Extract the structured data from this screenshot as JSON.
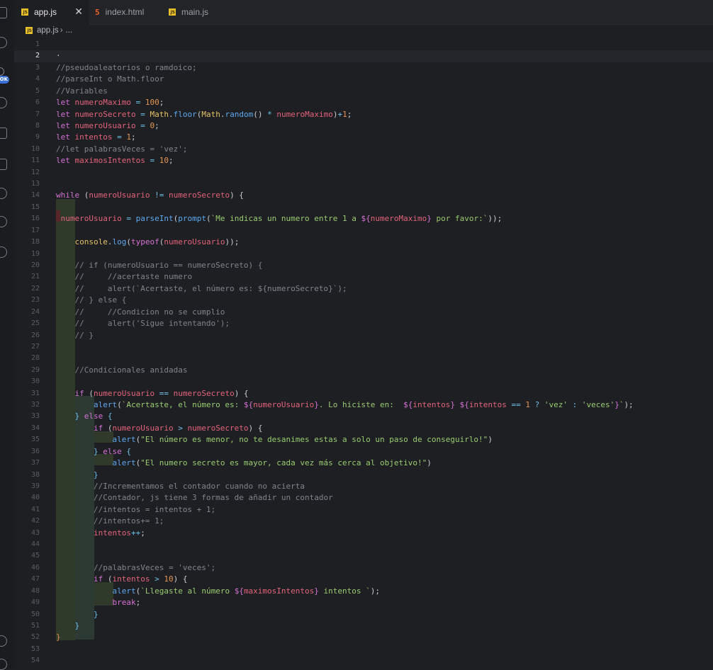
{
  "tabs": [
    {
      "label": "app.js",
      "type": "js",
      "active": true
    },
    {
      "label": "index.html",
      "type": "html",
      "active": false
    },
    {
      "label": "main.js",
      "type": "js",
      "active": false
    }
  ],
  "tab_close_glyph": "✕",
  "breadcrumb": {
    "file": "app.js",
    "rest": "..."
  },
  "activity_badge": "OK",
  "current_line": 2,
  "colors": {
    "keyword": "#d572d7",
    "variable": "#e4637c",
    "number": "#e59553",
    "operator": "#6fc2e8",
    "function": "#5ea9f0",
    "class": "#e5c268",
    "string": "#9acb72",
    "comment": "#7f848e"
  },
  "lines": [
    [],
    [
      [
        "pl",
        "·"
      ]
    ],
    [
      [
        "cm",
        "//pseudoaleatorios o ramdoico;"
      ]
    ],
    [
      [
        "cm",
        "//parseInt o Math.floor"
      ]
    ],
    [
      [
        "cm",
        "//Variables"
      ]
    ],
    [
      [
        "kw",
        "let "
      ],
      [
        "var",
        "numeroMaximo"
      ],
      [
        "op",
        " = "
      ],
      [
        "num",
        "100"
      ],
      [
        "pl",
        ";"
      ]
    ],
    [
      [
        "kw",
        "let "
      ],
      [
        "var",
        "numeroSecreto"
      ],
      [
        "op",
        " = "
      ],
      [
        "cls",
        "Math"
      ],
      [
        "pl",
        "."
      ],
      [
        "fn",
        "floor"
      ],
      [
        "pl",
        "("
      ],
      [
        "cls",
        "Math"
      ],
      [
        "pl",
        "."
      ],
      [
        "fn",
        "random"
      ],
      [
        "pl",
        "() "
      ],
      [
        "op",
        "* "
      ],
      [
        "var",
        "numeroMaximo"
      ],
      [
        "pl",
        ")"
      ],
      [
        "op",
        "+"
      ],
      [
        "num",
        "1"
      ],
      [
        "pl",
        ";"
      ]
    ],
    [
      [
        "kw",
        "let "
      ],
      [
        "var",
        "numeroUsuario"
      ],
      [
        "op",
        " = "
      ],
      [
        "num",
        "0"
      ],
      [
        "pl",
        ";"
      ]
    ],
    [
      [
        "kw",
        "let "
      ],
      [
        "var",
        "intentos"
      ],
      [
        "op",
        " = "
      ],
      [
        "num",
        "1"
      ],
      [
        "pl",
        ";"
      ]
    ],
    [
      [
        "cm",
        "//let palabrasVeces = 'vez';"
      ]
    ],
    [
      [
        "kw",
        "let "
      ],
      [
        "var",
        "maximosIntentos"
      ],
      [
        "op",
        " = "
      ],
      [
        "num",
        "10"
      ],
      [
        "pl",
        ";"
      ]
    ],
    [],
    [],
    [
      [
        "kw",
        "while "
      ],
      [
        "pl",
        "("
      ],
      [
        "var",
        "numeroUsuario"
      ],
      [
        "op",
        " != "
      ],
      [
        "var",
        "numeroSecreto"
      ],
      [
        "pl",
        ") {"
      ]
    ],
    [],
    [
      [
        "pl",
        " "
      ],
      [
        "var",
        "numeroUsuario"
      ],
      [
        "op",
        " = "
      ],
      [
        "fn",
        "parseInt"
      ],
      [
        "pl",
        "("
      ],
      [
        "fn",
        "prompt"
      ],
      [
        "pl",
        "("
      ],
      [
        "str",
        "`Me indicas un numero entre 1 a "
      ],
      [
        "kw",
        "${"
      ],
      [
        "var",
        "numeroMaximo"
      ],
      [
        "kw",
        "}"
      ],
      [
        "str",
        " por favor:`"
      ],
      [
        "pl",
        "));"
      ]
    ],
    [],
    [
      [
        "pl",
        "    "
      ],
      [
        "cls",
        "console"
      ],
      [
        "pl",
        "."
      ],
      [
        "fn",
        "log"
      ],
      [
        "pl",
        "("
      ],
      [
        "kw",
        "typeof"
      ],
      [
        "pl",
        "("
      ],
      [
        "var",
        "numeroUsuario"
      ],
      [
        "pl",
        "));"
      ]
    ],
    [],
    [
      [
        "pl",
        "    "
      ],
      [
        "cm",
        "// if (numeroUsuario == numeroSecreto) {"
      ]
    ],
    [
      [
        "pl",
        "    "
      ],
      [
        "cm",
        "//     //acertaste numero"
      ]
    ],
    [
      [
        "pl",
        "    "
      ],
      [
        "cm",
        "//     alert(`Acertaste, el número es: ${numeroSecreto}`);"
      ]
    ],
    [
      [
        "pl",
        "    "
      ],
      [
        "cm",
        "// } else {"
      ]
    ],
    [
      [
        "pl",
        "    "
      ],
      [
        "cm",
        "//     //Condicion no se cumplio"
      ]
    ],
    [
      [
        "pl",
        "    "
      ],
      [
        "cm",
        "//     alert('Sigue intentando');"
      ]
    ],
    [
      [
        "pl",
        "    "
      ],
      [
        "cm",
        "// }"
      ]
    ],
    [],
    [],
    [
      [
        "pl",
        "    "
      ],
      [
        "cm",
        "//Condicionales anidadas"
      ]
    ],
    [],
    [
      [
        "pl",
        "    "
      ],
      [
        "kw",
        "if "
      ],
      [
        "pl",
        "("
      ],
      [
        "var",
        "numeroUsuario"
      ],
      [
        "op",
        " == "
      ],
      [
        "var",
        "numeroSecreto"
      ],
      [
        "pl",
        ") {"
      ]
    ],
    [
      [
        "pl",
        "        "
      ],
      [
        "fn",
        "alert"
      ],
      [
        "pl",
        "("
      ],
      [
        "str",
        "`Acertaste, el número es: "
      ],
      [
        "kw",
        "${"
      ],
      [
        "var",
        "numeroUsuario"
      ],
      [
        "kw",
        "}"
      ],
      [
        "str",
        ". Lo hiciste en:  "
      ],
      [
        "kw",
        "${"
      ],
      [
        "var",
        "intentos"
      ],
      [
        "kw",
        "}"
      ],
      [
        "str",
        " "
      ],
      [
        "kw",
        "${"
      ],
      [
        "var",
        "intentos"
      ],
      [
        "op",
        " == "
      ],
      [
        "num",
        "1"
      ],
      [
        "op",
        " ? "
      ],
      [
        "str",
        "'vez'"
      ],
      [
        "op",
        " : "
      ],
      [
        "str",
        "'veces'"
      ],
      [
        "kw",
        "}"
      ],
      [
        "str",
        "`"
      ],
      [
        "pl",
        ");"
      ]
    ],
    [
      [
        "pl",
        "    "
      ],
      [
        "op",
        "} "
      ],
      [
        "kw",
        "else "
      ],
      [
        "op",
        "{"
      ]
    ],
    [
      [
        "pl",
        "        "
      ],
      [
        "kw",
        "if "
      ],
      [
        "pl",
        "("
      ],
      [
        "var",
        "numeroUsuario"
      ],
      [
        "op",
        " > "
      ],
      [
        "var",
        "numeroSecreto"
      ],
      [
        "pl",
        ") {"
      ]
    ],
    [
      [
        "pl",
        "            "
      ],
      [
        "fn",
        "alert"
      ],
      [
        "pl",
        "("
      ],
      [
        "str",
        "\"El número es menor, no te desanimes estas a solo un paso de conseguirlo!\""
      ],
      [
        "pl",
        ")"
      ]
    ],
    [
      [
        "pl",
        "        "
      ],
      [
        "op",
        "} "
      ],
      [
        "kw",
        "else "
      ],
      [
        "op",
        "{"
      ]
    ],
    [
      [
        "pl",
        "            "
      ],
      [
        "fn",
        "alert"
      ],
      [
        "pl",
        "("
      ],
      [
        "str",
        "\"El numero secreto es mayor, cada vez más cerca al objetivo!\""
      ],
      [
        "pl",
        ")"
      ]
    ],
    [
      [
        "pl",
        "        "
      ],
      [
        "op",
        "}"
      ]
    ],
    [
      [
        "pl",
        "        "
      ],
      [
        "cm",
        "//Incrementamos el contador cuando no acierta"
      ]
    ],
    [
      [
        "pl",
        "        "
      ],
      [
        "cm",
        "//Contador, js tiene 3 formas de añadir un contador"
      ]
    ],
    [
      [
        "pl",
        "        "
      ],
      [
        "cm",
        "//intentos = intentos + 1;"
      ]
    ],
    [
      [
        "pl",
        "        "
      ],
      [
        "cm",
        "//intentos+= 1;"
      ]
    ],
    [
      [
        "pl",
        "        "
      ],
      [
        "var",
        "intentos"
      ],
      [
        "op",
        "++"
      ],
      [
        "pl",
        ";"
      ]
    ],
    [],
    [],
    [
      [
        "pl",
        "        "
      ],
      [
        "cm",
        "//palabrasVeces = 'veces';"
      ]
    ],
    [
      [
        "pl",
        "        "
      ],
      [
        "kw",
        "if "
      ],
      [
        "pl",
        "("
      ],
      [
        "var",
        "intentos"
      ],
      [
        "op",
        " > "
      ],
      [
        "num",
        "10"
      ],
      [
        "pl",
        ") {"
      ]
    ],
    [
      [
        "pl",
        "            "
      ],
      [
        "fn",
        "alert"
      ],
      [
        "pl",
        "("
      ],
      [
        "str",
        "`Llegaste al número "
      ],
      [
        "kw",
        "${"
      ],
      [
        "var",
        "maximosIntentos"
      ],
      [
        "kw",
        "}"
      ],
      [
        "str",
        " intentos `"
      ],
      [
        "pl",
        ");"
      ]
    ],
    [
      [
        "pl",
        "            "
      ],
      [
        "kw",
        "break"
      ],
      [
        "pl",
        ";"
      ]
    ],
    [
      [
        "pl",
        "        "
      ],
      [
        "op",
        "}"
      ]
    ],
    [
      [
        "pl",
        "    "
      ],
      [
        "op",
        "}"
      ]
    ],
    [
      [
        "num",
        "}"
      ]
    ],
    [],
    []
  ]
}
